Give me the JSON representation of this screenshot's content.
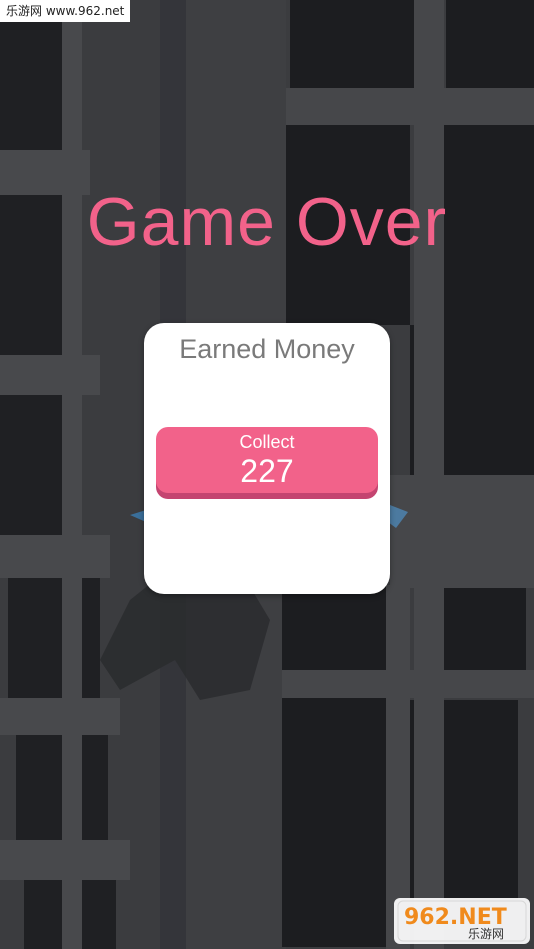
{
  "watermark": {
    "top_text": "乐游网 www.962.net",
    "logo_big": "962.NET",
    "logo_small": "乐游网"
  },
  "game_over": {
    "title": "Game Over"
  },
  "reward_card": {
    "heading": "Earned Money",
    "button_label": "Collect",
    "amount": "227"
  },
  "colors": {
    "accent_pink": "#f2628a",
    "button_shadow": "#c44470",
    "card_bg": "#ffffff",
    "heading_gray": "#7a7a7a",
    "scene_dark": "#2f3033"
  }
}
